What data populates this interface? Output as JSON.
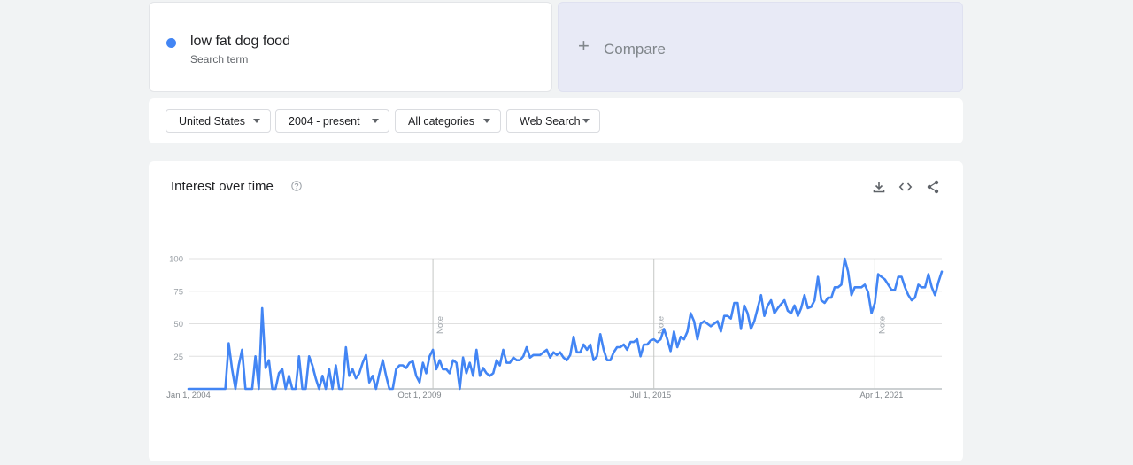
{
  "search_term": {
    "name": "low fat dog food",
    "sublabel": "Search term",
    "color": "#4285f4"
  },
  "compare": {
    "label": "Compare"
  },
  "filters": {
    "region": "United States",
    "time_range": "2004 - present",
    "category": "All categories",
    "search_type": "Web Search"
  },
  "widget": {
    "title": "Interest over time",
    "icons": [
      "help-icon",
      "download-icon",
      "embed-icon",
      "share-icon"
    ]
  },
  "chart_data": {
    "type": "line",
    "title": "Interest over time",
    "xlabel": "",
    "ylabel": "",
    "ylim": [
      0,
      100
    ],
    "yticks": [
      25,
      50,
      75,
      100
    ],
    "x_tick_labels": [
      "Jan 1, 2004",
      "Oct 1, 2009",
      "Jul 1, 2015",
      "Apr 1, 2021"
    ],
    "x_tick_months": [
      0,
      69,
      138,
      207
    ],
    "notes": [
      {
        "label": "Note",
        "month": 73
      },
      {
        "label": "Note",
        "month": 139
      },
      {
        "label": "Note",
        "month": 205
      }
    ],
    "series": [
      {
        "name": "low fat dog food",
        "color": "#4285f4",
        "values": [
          0,
          0,
          0,
          0,
          0,
          0,
          0,
          0,
          0,
          0,
          0,
          0,
          35,
          15,
          0,
          18,
          30,
          0,
          0,
          0,
          25,
          0,
          62,
          16,
          22,
          0,
          0,
          12,
          15,
          0,
          10,
          0,
          0,
          25,
          0,
          0,
          25,
          18,
          8,
          0,
          10,
          0,
          15,
          0,
          18,
          0,
          0,
          32,
          10,
          15,
          8,
          12,
          20,
          26,
          5,
          10,
          0,
          12,
          22,
          10,
          0,
          0,
          15,
          18,
          18,
          16,
          20,
          21,
          10,
          5,
          20,
          12,
          25,
          30,
          15,
          22,
          15,
          15,
          12,
          22,
          20,
          0,
          24,
          12,
          20,
          10,
          30,
          10,
          16,
          12,
          10,
          12,
          22,
          18,
          30,
          20,
          20,
          24,
          22,
          22,
          25,
          32,
          24,
          26,
          26,
          26,
          28,
          30,
          24,
          28,
          26,
          28,
          24,
          22,
          26,
          40,
          28,
          28,
          34,
          30,
          34,
          22,
          25,
          42,
          30,
          22,
          22,
          28,
          32,
          32,
          34,
          30,
          36,
          36,
          38,
          25,
          34,
          34,
          37,
          38,
          36,
          38,
          46,
          38,
          29,
          44,
          32,
          40,
          38,
          44,
          58,
          52,
          38,
          50,
          52,
          50,
          48,
          50,
          52,
          44,
          56,
          56,
          54,
          66,
          66,
          46,
          64,
          58,
          46,
          52,
          62,
          72,
          56,
          64,
          68,
          58,
          62,
          65,
          68,
          60,
          58,
          64,
          56,
          62,
          72,
          62,
          63,
          68,
          86,
          68,
          66,
          70,
          70,
          78,
          78,
          80,
          100,
          90,
          72,
          78,
          78,
          78,
          80,
          74,
          58,
          66,
          88,
          86,
          84,
          80,
          76,
          76,
          86,
          86,
          78,
          72,
          68,
          70,
          80,
          78,
          78,
          88,
          78,
          72,
          82,
          90
        ]
      }
    ]
  }
}
